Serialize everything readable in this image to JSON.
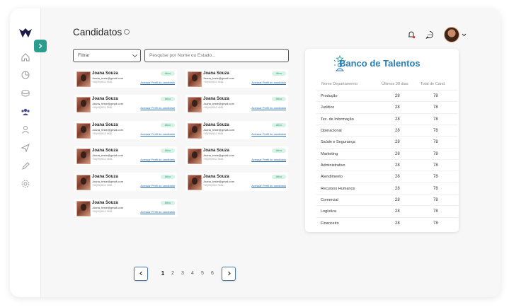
{
  "header": {
    "title": "Candidatos"
  },
  "filters": {
    "filter_label": "Filtrar",
    "search_placeholder": "Pesquise por Nome ou Estado..."
  },
  "cards": [
    {
      "name": "Joana Souza",
      "email": "Joana_teste@gmail.com",
      "phone": "+55(99)9812 9681",
      "status": "Ativo",
      "link": "Acessar Perfil do candidato"
    },
    {
      "name": "Joana Souza",
      "email": "Joana_teste@gmail.com",
      "phone": "+55(99)9812 9681",
      "status": "Ativo",
      "link": "Acessar Perfil do candidato"
    },
    {
      "name": "Joana Souza",
      "email": "Joana_teste@gmail.com",
      "phone": "+55(99)9812 9681",
      "status": "Ativo",
      "link": "Acessar Perfil do candidato"
    },
    {
      "name": "Joana Souza",
      "email": "Joana_teste@gmail.com",
      "phone": "+55(99)9812 9681",
      "status": "Ativo",
      "link": "Acessar Perfil do candidato"
    },
    {
      "name": "Joana Souza",
      "email": "Joana_teste@gmail.com",
      "phone": "+55(99)9812 9681",
      "status": "Ativo",
      "link": "Acessar Perfil do candidato"
    },
    {
      "name": "Joana Souza",
      "email": "Joana_teste@gmail.com",
      "phone": "+55(99)9812 9681",
      "status": "Ativo",
      "link": "Acessar Perfil do candidato"
    },
    {
      "name": "Joana Souza",
      "email": "Joana_teste@gmail.com",
      "phone": "+55(99)9812 9681",
      "status": "Ativo",
      "link": "Acessar Perfil do candidato"
    },
    {
      "name": "Joana Souza",
      "email": "Joana_teste@gmail.com",
      "phone": "+55(99)9812 9681",
      "status": "Ativo",
      "link": "Acessar Perfil do candidato"
    },
    {
      "name": "Joana Souza",
      "email": "Joana_teste@gmail.com",
      "phone": "+55(99)9812 9681",
      "status": "Ativo",
      "link": "Acessar Perfil do candidato"
    },
    {
      "name": "Joana Souza",
      "email": "Joana_teste@gmail.com",
      "phone": "+55(99)9812 9681",
      "status": "Ativo",
      "link": "Acessar Perfil do candidato"
    },
    {
      "name": "Joana Souza",
      "email": "Joana_teste@gmail.com",
      "phone": "+55(99)9812 9681",
      "status": "Ativo",
      "link": "Acessar Perfil do candidato"
    }
  ],
  "talent_bank": {
    "title": "Banco de Talentos",
    "headers": [
      "Nome Departamento",
      "Últimos 30 dias",
      "Total de Cand."
    ],
    "rows": [
      {
        "dept": "Produção",
        "last30": "28",
        "total": "78"
      },
      {
        "dept": "Jurídico",
        "last30": "28",
        "total": "78"
      },
      {
        "dept": "Tec. de Informação",
        "last30": "28",
        "total": "78"
      },
      {
        "dept": "Operacional",
        "last30": "28",
        "total": "78"
      },
      {
        "dept": "Saúde e Segurança",
        "last30": "28",
        "total": "78"
      },
      {
        "dept": "Marketing",
        "last30": "28",
        "total": "78"
      },
      {
        "dept": "Administrativo",
        "last30": "28",
        "total": "78"
      },
      {
        "dept": "Atendimento",
        "last30": "28",
        "total": "78"
      },
      {
        "dept": "Recursos Humanos",
        "last30": "28",
        "total": "78"
      },
      {
        "dept": "Comercial",
        "last30": "28",
        "total": "78"
      },
      {
        "dept": "Logística",
        "last30": "28",
        "total": "78"
      },
      {
        "dept": "Financeiro",
        "last30": "28",
        "total": "78"
      }
    ]
  },
  "pagination": {
    "pages": [
      "1",
      "2",
      "3",
      "4",
      "5",
      "6"
    ],
    "current": "1"
  },
  "colors": {
    "accent": "#2a9d8f",
    "status_active_bg": "#d7f3e6",
    "status_active_text": "#2aa36f",
    "title_blue": "#2a7fb8",
    "link_blue": "#2a6db0"
  },
  "icons": {
    "sidebar": [
      "home-icon",
      "chart-icon",
      "box-icon",
      "people-icon",
      "user-icon",
      "send-icon",
      "edit-icon",
      "settings-icon"
    ],
    "topbar": [
      "bell-icon",
      "chat-icon",
      "chevron-down-icon"
    ]
  }
}
